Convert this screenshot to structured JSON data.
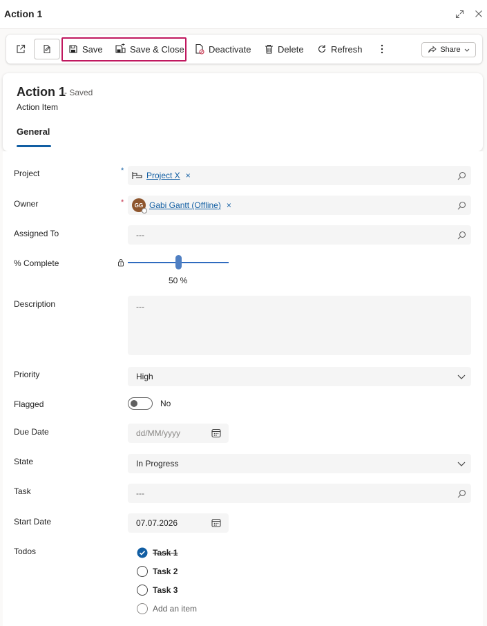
{
  "window": {
    "title": "Action 1",
    "icons": {
      "expand": "expand-icon",
      "close": "close-icon"
    }
  },
  "toolbar": {
    "save_label": "Save",
    "save_close_label": "Save & Close",
    "deactivate_label": "Deactivate",
    "delete_label": "Delete",
    "refresh_label": "Refresh",
    "share_label": "Share",
    "highlight_color": "#c0185f"
  },
  "record": {
    "title": "Action 1",
    "status": "- Saved",
    "entity": "Action Item",
    "tab": "General"
  },
  "fields": {
    "project": {
      "label": "Project",
      "required_mark": "*",
      "value": "Project X",
      "remove": "×"
    },
    "owner": {
      "label": "Owner",
      "required_mark": "*",
      "initials": "GG",
      "value": "Gabi Gantt (Offline)",
      "remove": "×"
    },
    "assigned_to": {
      "label": "Assigned To",
      "value": "---"
    },
    "percent_complete": {
      "label": "% Complete",
      "value": 50,
      "display": "50 %"
    },
    "description": {
      "label": "Description",
      "value": "---"
    },
    "priority": {
      "label": "Priority",
      "value": "High"
    },
    "flagged": {
      "label": "Flagged",
      "value": "No"
    },
    "due_date": {
      "label": "Due Date",
      "placeholder": "dd/MM/yyyy"
    },
    "state": {
      "label": "State",
      "value": "In Progress"
    },
    "task": {
      "label": "Task",
      "value": "---"
    },
    "start_date": {
      "label": "Start Date",
      "value": "07.07.2026"
    },
    "todos": {
      "label": "Todos",
      "items": [
        {
          "text": "Task 1",
          "done": true
        },
        {
          "text": "Task 2",
          "done": false
        },
        {
          "text": "Task 3",
          "done": false
        }
      ],
      "add_label": "Add an item"
    }
  },
  "colors": {
    "accent": "#115ea3",
    "slider": "#2f6bbf",
    "required": "#c4314b"
  }
}
